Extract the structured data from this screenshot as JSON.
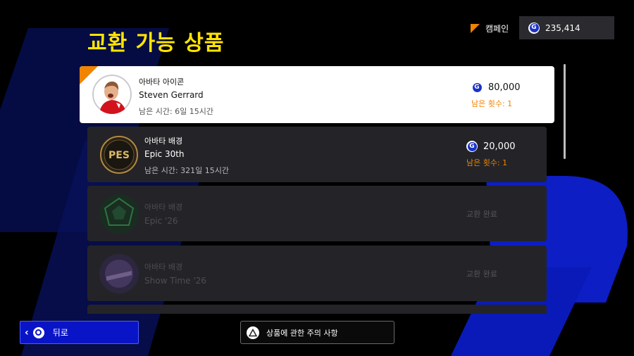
{
  "header": {
    "title": "교환 가능 상품",
    "campaign_label": "캠페인",
    "currency_icon": "G",
    "currency_amount": "235,414"
  },
  "items": [
    {
      "type": "아바타 아이콘",
      "name": "Steven Gerrard",
      "time": "남은 시간: 6일 15시간",
      "price": "80,000",
      "remaining": "남은 횟수: 1",
      "status": "available",
      "selected": true
    },
    {
      "type": "아바타 배경",
      "name": "Epic 30th",
      "time": "남은 시간: 321일 15시간",
      "price": "20,000",
      "remaining": "남은 횟수: 1",
      "status": "available",
      "selected": false
    },
    {
      "type": "아바타 배경",
      "name": "Epic '26",
      "status_text": "교환 완료",
      "status": "exchanged"
    },
    {
      "type": "아바타 배경",
      "name": "Show Time '26",
      "status_text": "교환 완료",
      "status": "exchanged"
    }
  ],
  "footer": {
    "back_label": "뒤로",
    "notice_label": "상품에 관한 주의 사항"
  },
  "colors": {
    "title": "#ffe500",
    "accent_orange": "#f08400",
    "back_button": "#0a14c7",
    "card": "#242428",
    "coin": "#1b33c8"
  }
}
